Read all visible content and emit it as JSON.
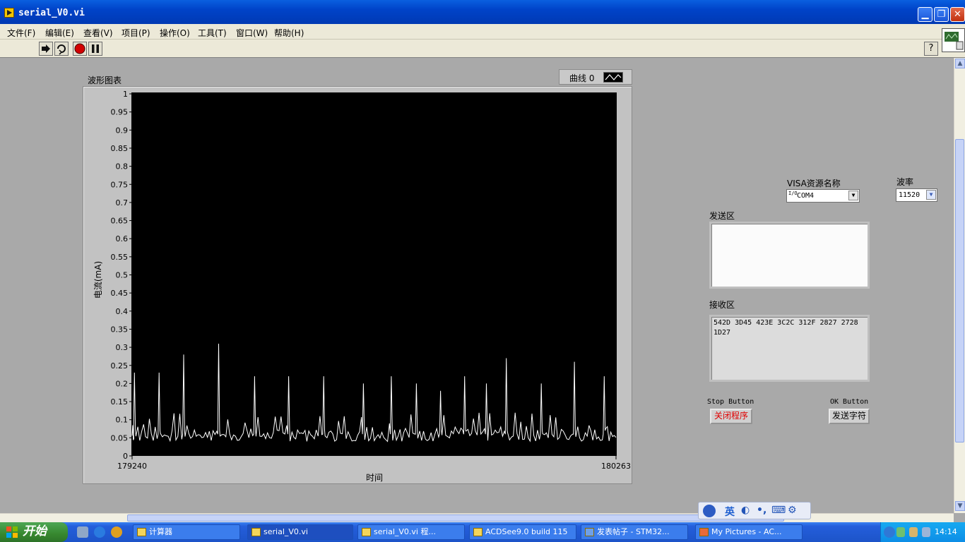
{
  "window": {
    "title": "serial_V0.vi"
  },
  "menubar": [
    "文件(F)",
    "编辑(E)",
    "查看(V)",
    "项目(P)",
    "操作(O)",
    "工具(T)",
    "窗口(W)",
    "帮助(H)"
  ],
  "toolbar": {
    "help": "?"
  },
  "chart": {
    "label": "波形图表",
    "legend": "曲线 0",
    "xlabel": "时间",
    "ylabel": "电流(mA)"
  },
  "chart_data": {
    "type": "line",
    "title": "波形图表",
    "xlabel": "时间",
    "ylabel": "电流(mA)",
    "xlim": [
      179240,
      180263
    ],
    "ylim": [
      0,
      1
    ],
    "x_tick_labels": [
      "179240",
      "180263"
    ],
    "y_tick_labels": [
      "0",
      "0.05",
      "0.1",
      "0.15",
      "0.2",
      "0.25",
      "0.3",
      "0.35",
      "0.4",
      "0.45",
      "0.5",
      "0.55",
      "0.6",
      "0.65",
      "0.7",
      "0.75",
      "0.8",
      "0.85",
      "0.9",
      "0.95",
      "1"
    ],
    "series": [
      {
        "name": "曲线 0",
        "color": "#ffffff",
        "peaks": [
          {
            "x": 179245,
            "y": 0.23
          },
          {
            "x": 179297,
            "y": 0.23
          },
          {
            "x": 179349,
            "y": 0.28
          },
          {
            "x": 179423,
            "y": 0.31
          },
          {
            "x": 179499,
            "y": 0.22
          },
          {
            "x": 179571,
            "y": 0.22
          },
          {
            "x": 179645,
            "y": 0.22
          },
          {
            "x": 179729,
            "y": 0.2
          },
          {
            "x": 179788,
            "y": 0.22
          },
          {
            "x": 179841,
            "y": 0.2
          },
          {
            "x": 179892,
            "y": 0.18
          },
          {
            "x": 179943,
            "y": 0.22
          },
          {
            "x": 179989,
            "y": 0.2
          },
          {
            "x": 180031,
            "y": 0.27
          },
          {
            "x": 180105,
            "y": 0.2
          },
          {
            "x": 180175,
            "y": 0.26
          },
          {
            "x": 180238,
            "y": 0.22
          }
        ],
        "baseline": [
          0.04,
          0.12
        ]
      }
    ]
  },
  "controls": {
    "visa_label": "VISA资源名称",
    "visa_value": "COM4",
    "visa_prefix": "I/O",
    "baud_label": "波率",
    "baud_value": "11520",
    "send_label": "发送区",
    "send_value": "",
    "recv_label": "接收区",
    "recv_value": "542D 3D45 423E 3C2C 312F 2827 2728\n1D27",
    "stop_caption": "Stop Button",
    "stop_button": "关闭程序",
    "ok_caption": "OK Button",
    "ok_button": "发送字符"
  },
  "colors": {
    "panel_bg": "#a9a9a9",
    "plot_bg": "#000000",
    "trace": "#ffffff",
    "stop_text": "#e00000"
  },
  "taskbar": {
    "start": "开始",
    "tasks": [
      "计算器",
      "serial_V0.vi",
      "serial_V0.vi 程...",
      "ACDSee9.0 build 115",
      "发表帖子 - STM32...",
      "My Pictures - AC..."
    ],
    "clock": "14:14"
  },
  "ime": {
    "mode": "英"
  }
}
